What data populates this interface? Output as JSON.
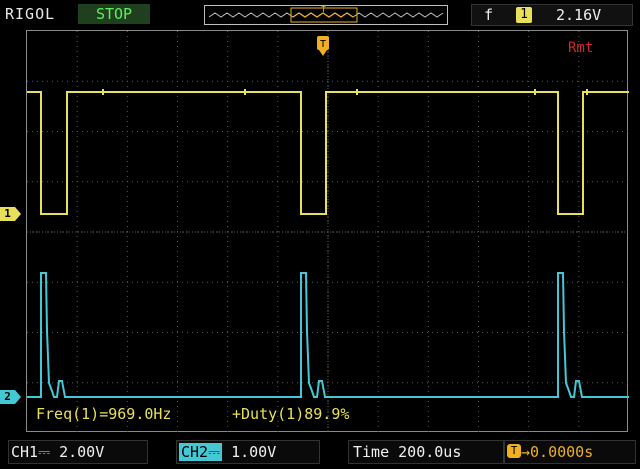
{
  "header": {
    "brand": "RIGOL",
    "run_status": "STOP",
    "trigger": {
      "edge_symbol": "f",
      "source": "1",
      "level": "2.16V"
    }
  },
  "screen": {
    "remote_label": "Rmt",
    "trigger_marker": "T",
    "ch1_marker": "1",
    "ch2_marker": "2",
    "colors": {
      "ch1": "#e9e05a",
      "ch2": "#43c9d6",
      "grid": "#5a5a5a",
      "remote": "#d62525"
    }
  },
  "measurements": {
    "freq": "Freq(1)=969.0Hz",
    "duty": "+Duty(1)89.9%"
  },
  "footer": {
    "ch1": "CH1⎓  2.00V",
    "ch2_tag": "CH2⎓",
    "ch2_scale": "  1.00V",
    "time": "Time 200.0us",
    "offset_icon": "T",
    "offset": "→0.0000s"
  }
}
